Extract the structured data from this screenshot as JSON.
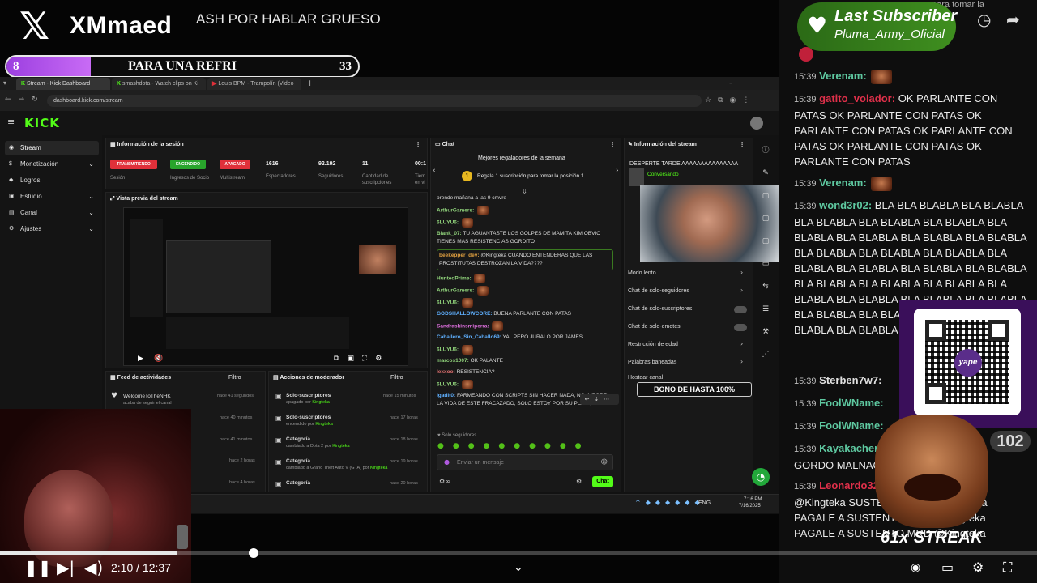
{
  "overlay": {
    "brand": "XMmaed",
    "stream_title": "ASH POR HABLAR GRUESO",
    "goal": {
      "left_count": "8",
      "label": "PARA UNA REFRI",
      "right_count": "33",
      "progress": 0.24
    }
  },
  "browser": {
    "tabs": [
      {
        "label": "Stream - Kick Dashboard"
      },
      {
        "label": "smashdota - Watch clips on Ki"
      },
      {
        "label": "Louis BPM - Trampolín (Video C"
      }
    ],
    "url": "dashboard.kick.com/stream"
  },
  "kick": {
    "logo": "KICK",
    "sidebar": [
      "Stream",
      "Monetización",
      "Logros",
      "Estudio",
      "Canal",
      "Ajustes"
    ],
    "session_title": "Información de la sesión",
    "chips": [
      {
        "label": "TRANSMITIENDO",
        "sub": "Sesión",
        "color": "#e0303a"
      },
      {
        "label": "ENCENDIDO",
        "sub": "Ingresos de Socio",
        "color": "#29a52c"
      },
      {
        "label": "APAGADO",
        "sub": "Multistream",
        "color": "#e0303a"
      }
    ],
    "stats": [
      {
        "value": "1616",
        "label": "Espectadores"
      },
      {
        "value": "92.192",
        "label": "Seguidores"
      },
      {
        "value": "11",
        "label": "Cantidad de suscripciones"
      },
      {
        "value": "00:1",
        "label": "Tiem en vi"
      }
    ],
    "preview_title": "Vista previa del stream",
    "chat_title": "Chat",
    "top_gifters": "Mejores regaladores de la semana",
    "gift_prompt": "Regala 1 suscripción para tomar la posición 1",
    "chat_lines": [
      {
        "user": "",
        "text": "prende mañana a las 9 cmvre",
        "color": "#ddd"
      },
      {
        "user": "ArthurGamers:",
        "text": "",
        "color": "#8fd17a"
      },
      {
        "user": "6LUYU6:",
        "text": "",
        "color": "#8fd17a"
      },
      {
        "user": "Blank_07:",
        "text": "TU AGUANTASTE LOS GOLPES DE MAMITA KIM OBVIO TIENES MAS RESISTENCIAS GORDITO",
        "color": "#8fd17a"
      },
      {
        "user": "beekepper_dev:",
        "text": "@Kingteka CUANDO ENTENDERAS QUE LAS PROSTITUTAS DESTROZAN LA VIDA????",
        "color": "#e0a040"
      },
      {
        "user": "HuntedPrime:",
        "text": "",
        "color": "#8fd17a"
      },
      {
        "user": "ArthurGamers:",
        "text": "",
        "color": "#8fd17a"
      },
      {
        "user": "6LUYU6:",
        "text": "",
        "color": "#8fd17a"
      },
      {
        "user": "GODSHALLOWCORE:",
        "text": "BUENA PARLANTE CON PATAS",
        "color": "#5fb0ff"
      },
      {
        "user": "Sandraskinsmiperra:",
        "text": "",
        "color": "#e070e0"
      },
      {
        "user": "Caballero_Sin_Caballo69:",
        "text": "YA . PERO JURALO POR JAMES",
        "color": "#5fb0ff"
      },
      {
        "user": "6LUYU6:",
        "text": "",
        "color": "#8fd17a"
      },
      {
        "user": "marcos1007:",
        "text": "OK PALANTE",
        "color": "#8fd17a"
      },
      {
        "user": "lexxoo:",
        "text": "RESISTENCIA?",
        "color": "#e07070"
      },
      {
        "user": "6LUYU6:",
        "text": "",
        "color": "#8fd17a"
      },
      {
        "user": "Igadit0:",
        "text": "FARMEANDO CON SCRIPTS SIN HACER NADA, NO IMPORTA LA VIDA DE ESTE FRACAZADO, SOLO ESTOY POR SU PLATA, ALAMOS",
        "color": "#5fb0ff"
      }
    ],
    "followers_only": "Solo seguidores",
    "chat_placeholder": "Enviar un mensaje",
    "chat_button": "Chat",
    "stream_info_title": "Información del stream",
    "stream_info_text": "DESPERTE TARDE AAAAAAAAAAAAAAA",
    "stream_category": "Conversando",
    "settings": [
      "Modo lento",
      "Chat de solo-seguidores",
      "Chat de solo-suscriptores",
      "Chat de solo-emotes",
      "Restricción de edad",
      "Palabras baneadas",
      "Hostear canal"
    ],
    "bonus": "BONO DE HASTA 100%",
    "feed_title": "Feed de actividades",
    "feed_filter": "Filtro",
    "feed_user": "WelcomeToTheNHK",
    "feed_action": "acaba de seguir el canal",
    "feed_times": [
      "hace 41 segundos",
      "hace 40 minutos",
      "hace 41 minutos",
      "hace 2 horas",
      "hace 4 horas"
    ],
    "mod_title": "Acciones de moderador",
    "mod_filter": "Filtro",
    "mod_actions": [
      {
        "title": "Solo-suscriptores",
        "sub": "apagado por",
        "by": "Kingteka",
        "time": "hace 15 minutos"
      },
      {
        "title": "Solo-suscriptores",
        "sub": "encendido por",
        "by": "Kingteka",
        "time": "hace 17 horas"
      },
      {
        "title": "Categoría",
        "sub": "cambiado a Dota 2 por",
        "by": "Kingteka",
        "time": "hace 18 horas"
      },
      {
        "title": "Categoría",
        "sub": "cambiado a Grand Theft Auto V (GTA) por",
        "by": "Kingteka",
        "time": "hace 19 horas"
      },
      {
        "title": "Categoría",
        "sub": "",
        "by": "",
        "time": "hace 20 horas"
      }
    ],
    "taskbar": {
      "lang": "ENG",
      "time": "7:16 PM",
      "date": "7/16/2025"
    }
  },
  "player": {
    "current": "2:10",
    "duration": "12:37",
    "progress": 0.17
  },
  "last_subscriber": {
    "title": "Last Subscriber",
    "name": "Pluma_Army_Oficial",
    "partial_text": "para tomar la"
  },
  "right_chat": [
    {
      "time": "15:39",
      "user": "Verenam:",
      "color": "#5ec8a0",
      "text": "",
      "emotes": 1
    },
    {
      "time": "15:39",
      "user": "gatito_volador:",
      "color": "#e0304a",
      "text": "OK PARLANTE CON PATAS OK PARLANTE CON PATAS OK PARLANTE CON PATAS OK PARLANTE CON PATAS OK PARLANTE CON PATAS OK PARLANTE CON PATAS",
      "emotes": 0
    },
    {
      "time": "15:39",
      "user": "Verenam:",
      "color": "#5ec8a0",
      "text": "",
      "emotes": 1
    },
    {
      "time": "15:39",
      "user": "wond3r02:",
      "color": "#5ec8a0",
      "text": "BLA BLA BLABLA BLA BLABLA BLA BLABLA BLA BLABLA BLA BLABLA BLA BLABLA BLA BLABLA BLA BLABLA BLA BLABLA BLA BLABLA BLA BLABLA BLA BLABLA BLA BLABLA BLA BLABLA BLA BLABLA BLA BLABLA BLA BLABLA BLA BLABLA BLA BLABLA BLA BLABLA BLA BLABLA BLA BLABLA BLA BLABLA BLA BLABLA BLA BLABLA BLA BLABLA BLA BLABLA BLA BLABLA",
      "emotes": 0
    },
    {
      "time": "15:39",
      "user": "Sterben7w7:",
      "color": "#e0e0e0",
      "text": "",
      "emotes": 0
    },
    {
      "time": "15:39",
      "user": "FoolWName:",
      "color": "#5ec8a0",
      "text": "",
      "emotes": 0
    },
    {
      "time": "15:39",
      "user": "FoolWName:",
      "color": "#5ec8a0",
      "text": "",
      "emotes": 0
    },
    {
      "time": "15:39",
      "user": "Kayakacher",
      "color": "#5ec8a0",
      "text": "GORDO MALNAC",
      "emotes": 0
    },
    {
      "time": "15:39",
      "user": "Leonardo32",
      "color": "#e0304a",
      "text": "MRD @Kingteka MRD @Kingteka SUSTENTO MRD @Kingteka PAGALE A SUSTENTO MRD @Kingteka PAGALE A SUSTENTO MRD @Kingteka",
      "emotes": 0
    }
  ],
  "overlays_right": {
    "streak": "61x STREAK",
    "badge_count": "102",
    "qr_brand": "yape"
  }
}
